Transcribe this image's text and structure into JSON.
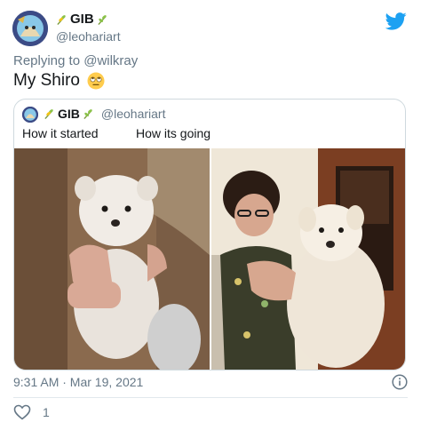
{
  "author": {
    "name": "GIB",
    "handle": "@leohariart"
  },
  "reply": {
    "label": "Replying to @wilkray"
  },
  "tweet": {
    "text": "My Shiro"
  },
  "quoted": {
    "name": "GIB",
    "handle": "@leohariart",
    "left_caption": "How it started",
    "right_caption": "How its going"
  },
  "footer": {
    "timestamp": "9:31 AM · Mar 19, 2021",
    "like_count": "1"
  },
  "colors": {
    "twitter_blue": "#1da1f2",
    "secondary_text": "#657786",
    "border": "#cfd9de"
  },
  "icons": [
    "twitter-bird-icon",
    "plant-icon",
    "info-icon",
    "heart-icon",
    "rolling-eyes-emoji"
  ]
}
